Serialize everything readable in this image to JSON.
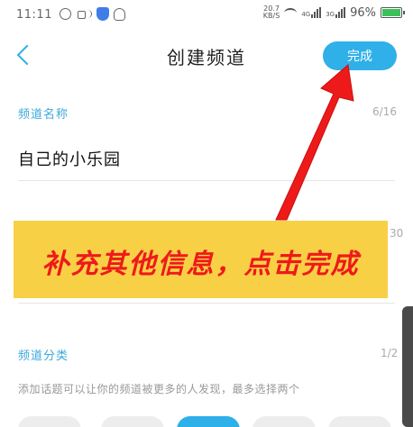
{
  "status_bar": {
    "time": "11:11",
    "net_speed_value": "20.7",
    "net_speed_unit": "KB/S",
    "signal_1": "4G",
    "signal_2": "3G",
    "battery": "96%"
  },
  "header": {
    "title": "创建频道",
    "done_label": "完成"
  },
  "form": {
    "name_label": "频道名称",
    "name_counter": "6/16",
    "name_value": "自己的小乐园",
    "desc_counter_partial": "30",
    "category_label": "频道分类",
    "category_counter": "1/2",
    "category_hint": "添加话题可以让你的频道被更多的人发现，最多选择两个"
  },
  "annotation": {
    "banner_text": "补充其他信息，点击完成",
    "colors": {
      "banner_bg": "#f8d046",
      "text": "#ee1a1a",
      "arrow": "#ee1a1a"
    }
  },
  "colors": {
    "accent": "#2fb0e8"
  }
}
